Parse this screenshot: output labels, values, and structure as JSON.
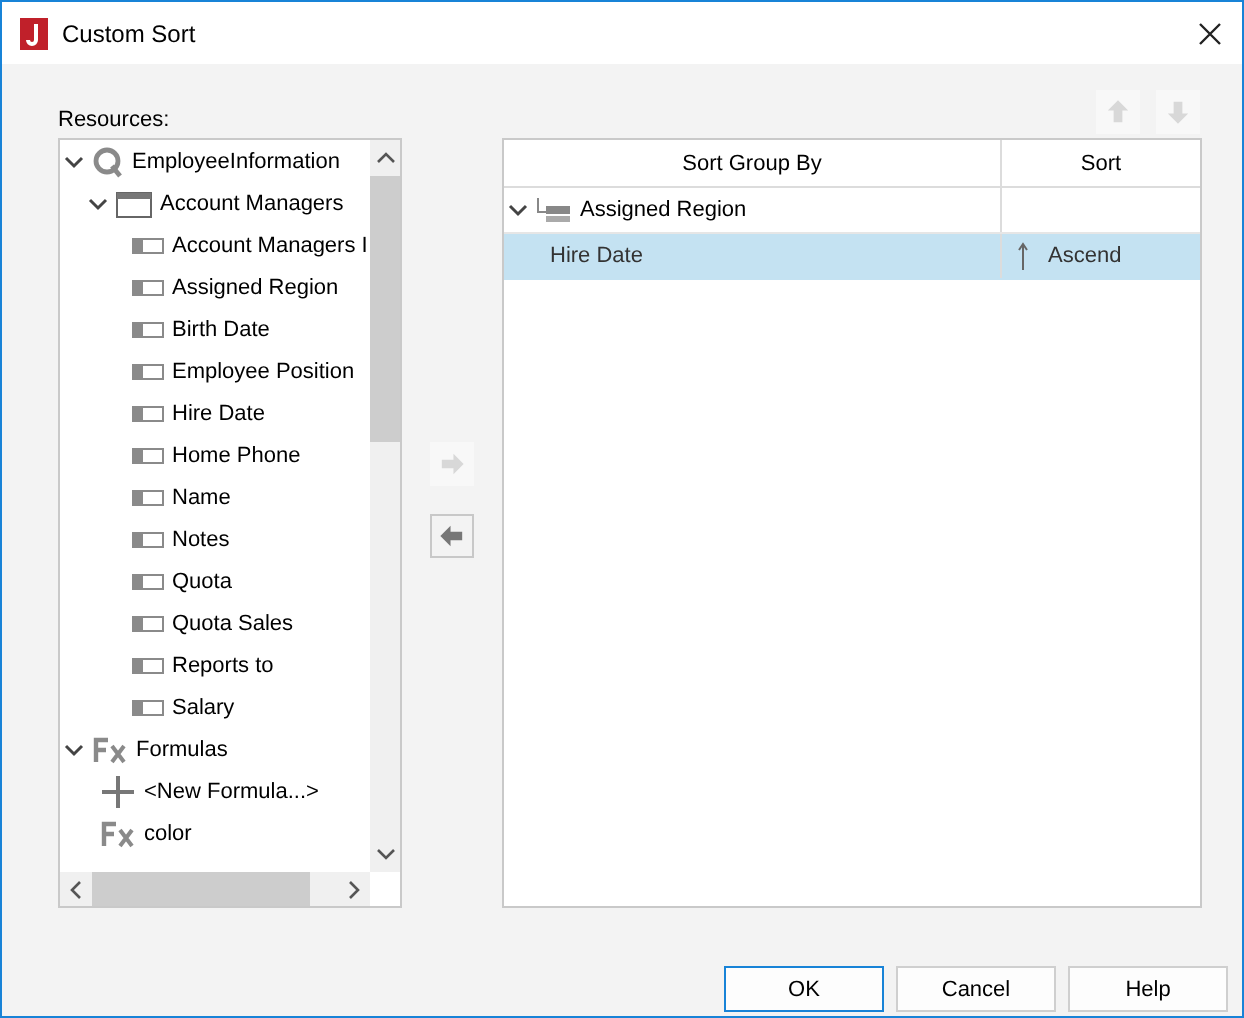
{
  "window": {
    "title": "Custom Sort"
  },
  "resources": {
    "label": "Resources:",
    "tree": [
      {
        "kind": "query",
        "label": "EmployeeInformation",
        "expanded": true,
        "children": [
          {
            "kind": "table",
            "label": "Account Managers",
            "expanded": true,
            "children": [
              {
                "kind": "field",
                "label": "Account Managers I"
              },
              {
                "kind": "field",
                "label": "Assigned Region"
              },
              {
                "kind": "field",
                "label": "Birth Date"
              },
              {
                "kind": "field",
                "label": "Employee Position"
              },
              {
                "kind": "field",
                "label": "Hire Date"
              },
              {
                "kind": "field",
                "label": "Home Phone"
              },
              {
                "kind": "field",
                "label": "Name"
              },
              {
                "kind": "field",
                "label": "Notes"
              },
              {
                "kind": "field",
                "label": "Quota"
              },
              {
                "kind": "field",
                "label": "Quota Sales"
              },
              {
                "kind": "field",
                "label": "Reports to"
              },
              {
                "kind": "field",
                "label": "Salary"
              }
            ]
          }
        ]
      },
      {
        "kind": "formulas",
        "label": "Formulas",
        "expanded": true,
        "children": [
          {
            "kind": "new",
            "label": "<New Formula...>"
          },
          {
            "kind": "formula",
            "label": "color"
          }
        ]
      }
    ]
  },
  "move_buttons": [
    {
      "kind": "right",
      "disabled": true
    },
    {
      "kind": "left",
      "disabled": false
    }
  ],
  "order_buttons": [
    {
      "kind": "up",
      "disabled": true
    },
    {
      "kind": "down",
      "disabled": true
    }
  ],
  "sort_table": {
    "columns": [
      "Sort Group By",
      "Sort"
    ],
    "rows": [
      {
        "kind": "group",
        "label": "Assigned Region",
        "expanded": true,
        "selected": false
      },
      {
        "kind": "field",
        "label": "Hire Date",
        "sort": "Ascend",
        "selected": true
      }
    ]
  },
  "buttons": [
    {
      "label": "OK",
      "default": true
    },
    {
      "label": "Cancel",
      "default": false
    },
    {
      "label": "Help",
      "default": false
    }
  ]
}
